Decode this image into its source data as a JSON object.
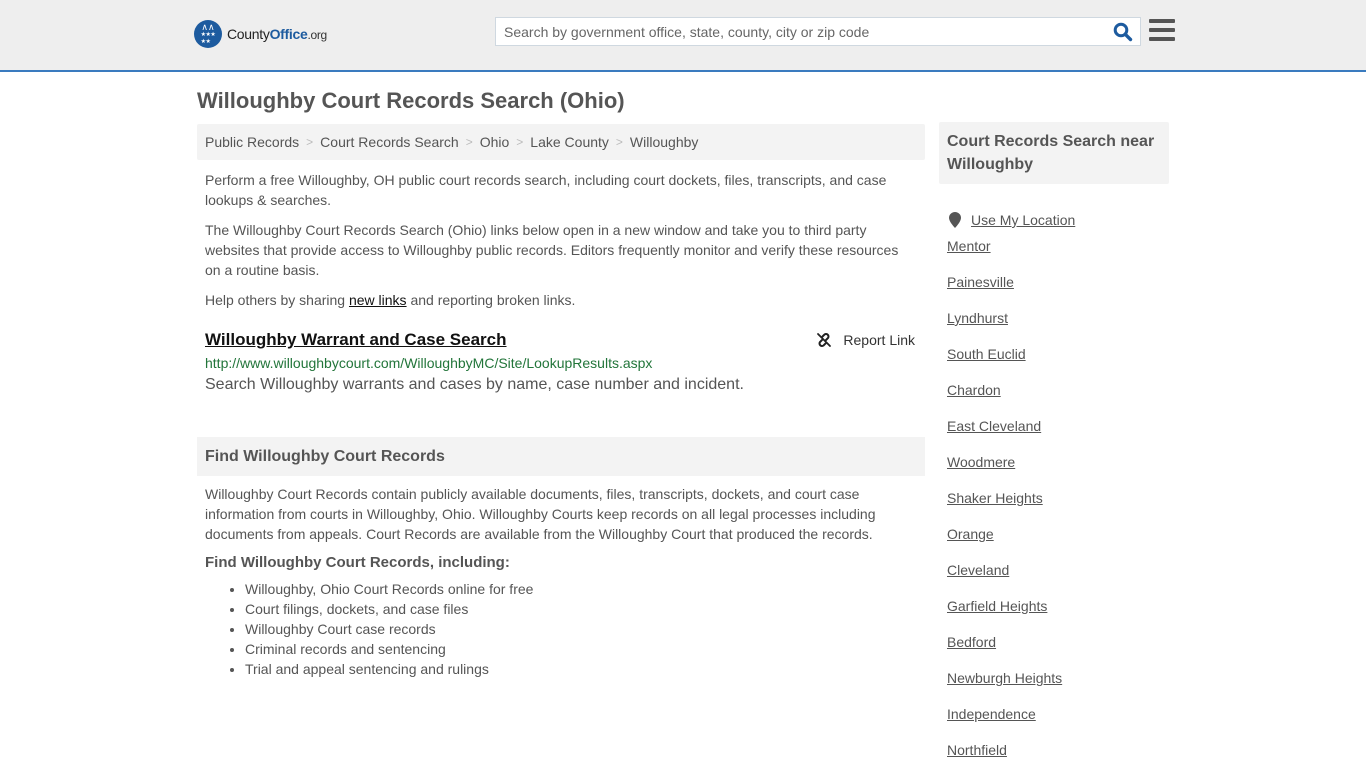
{
  "header": {
    "logo": {
      "name_prefix": "County",
      "name_brand": "Office",
      "name_suffix": ".org"
    },
    "search": {
      "placeholder": "Search by government office, state, county, city or zip code",
      "value": ""
    }
  },
  "page_title": "Willoughby Court Records Search (Ohio)",
  "breadcrumb": [
    "Public Records",
    "Court Records Search",
    "Ohio",
    "Lake County",
    "Willoughby"
  ],
  "breadcrumb_separator": ">",
  "intro": {
    "p1": "Perform a free Willoughby, OH public court records search, including court dockets, files, transcripts, and case lookups & searches.",
    "p2": "The Willoughby Court Records Search (Ohio) links below open in a new window and take you to third party websites that provide access to Willoughby public records. Editors frequently monitor and verify these resources on a routine basis.",
    "p3_before": "Help others by sharing ",
    "p3_link": "new links",
    "p3_after": " and reporting broken links."
  },
  "results": [
    {
      "title": "Willoughby Warrant and Case Search",
      "url": "http://www.willoughbycourt.com/WilloughbyMC/Site/LookupResults.aspx",
      "description": "Search Willoughby warrants and cases by name, case number and incident.",
      "report_label": "Report Link"
    }
  ],
  "find_section": {
    "heading": "Find Willoughby Court Records",
    "body": "Willoughby Court Records contain publicly available documents, files, transcripts, dockets, and court case information from courts in Willoughby, Ohio. Willoughby Courts keep records on all legal processes including documents from appeals. Court Records are available from the Willoughby Court that produced the records.",
    "subheading": "Find Willoughby Court Records, including:",
    "items": [
      "Willoughby, Ohio Court Records online for free",
      "Court filings, dockets, and case files",
      "Willoughby Court case records",
      "Criminal records and sentencing",
      "Trial and appeal sentencing and rulings"
    ]
  },
  "sidebar": {
    "heading": "Court Records Search near Willoughby",
    "use_location": "Use My Location",
    "cities": [
      "Mentor",
      "Painesville",
      "Lyndhurst",
      "South Euclid",
      "Chardon",
      "East Cleveland",
      "Woodmere",
      "Shaker Heights",
      "Orange",
      "Cleveland",
      "Garfield Heights",
      "Bedford",
      "Newburgh Heights",
      "Independence",
      "Northfield"
    ]
  },
  "colors": {
    "brand_blue": "#1d5b9f",
    "header_border": "#3a7bbf",
    "url_green": "#22753a"
  }
}
